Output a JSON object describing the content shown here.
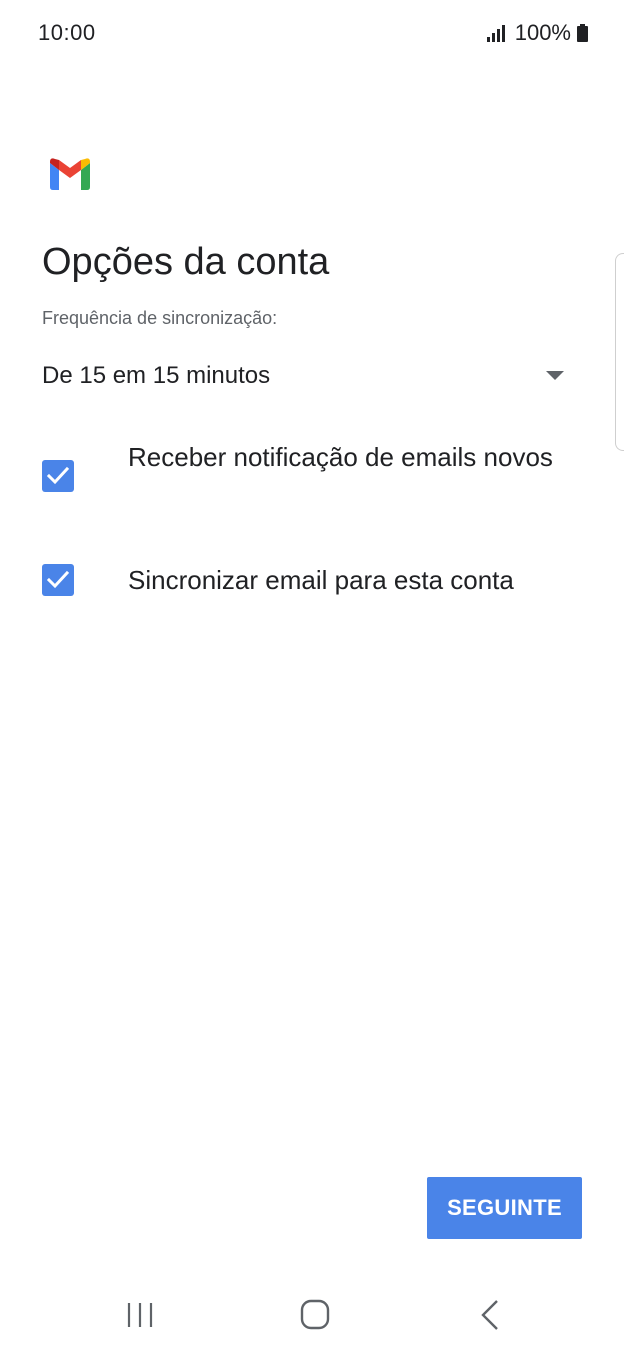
{
  "status_bar": {
    "time": "10:00",
    "battery_percent": "100%",
    "signal_icon": "signal-bars-icon",
    "battery_icon": "battery-full-icon"
  },
  "app": {
    "logo_icon": "gmail-logo-icon"
  },
  "page": {
    "title": "Opções da conta",
    "sync_frequency_label": "Frequência de sincronização:",
    "sync_frequency_value": "De 15 em 15 minutos"
  },
  "options": {
    "notify_label": "Receber notificação de emails novos",
    "notify_checked": true,
    "sync_label": "Sincronizar email para esta conta",
    "sync_checked": true
  },
  "actions": {
    "next_label": "SEGUINTE"
  },
  "colors": {
    "accent": "#4a84e8",
    "text_primary": "#202124",
    "text_secondary": "#5f6368"
  },
  "navigation": {
    "recents_icon": "recents-icon",
    "home_icon": "home-icon",
    "back_icon": "back-icon"
  }
}
